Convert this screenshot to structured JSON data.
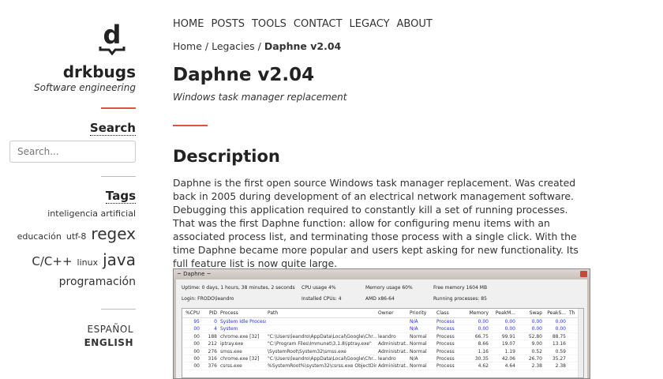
{
  "site": {
    "name": "drkbugs",
    "tagline": "Software engineering",
    "logo_letter": "d"
  },
  "search": {
    "heading": "Search",
    "placeholder": "Search..."
  },
  "tags": {
    "heading": "Tags",
    "items": [
      "inteligencia artificial",
      "educación",
      "utf-8",
      "regex",
      "C/C++",
      "linux",
      "java",
      "programación"
    ]
  },
  "languages": [
    "ESPAÑOL",
    "ENGLISH"
  ],
  "nav": [
    "HOME",
    "POSTS",
    "TOOLS",
    "CONTACT",
    "LEGACY",
    "ABOUT"
  ],
  "breadcrumb": {
    "home": "Home",
    "legacies": "Legacies",
    "current": "Daphne v2.04"
  },
  "page": {
    "title": "Daphne v2.04",
    "subtitle": "Windows task manager replacement",
    "section": "Description",
    "paragraph": "Daphne is the first open source Windows task manager replacement. Was created back in 2005 during development of an electrical network management software. Debugging this application required to constantly kill a set of running processes. That was the first Daphne function: allow for configuring menu items with an associated process list, and terminating those process with a single click. With the time Daphne became more popular and users kept asking for new functionality. Its full feature list is now quite large."
  },
  "screenshot": {
    "title": "~ Daphne ~",
    "info": [
      "Uptime: 0 days, 1 hours, 38 minutes, 2 seconds",
      "CPU usage  4%",
      "Memory usage  60%",
      "Free memory 1604 MB",
      "Login: FRODO\\leandro",
      "Installed CPUs:  4",
      "AMD x86-64",
      "Running processes:   85"
    ],
    "columns": [
      "%CPU",
      "PID",
      "Process",
      "Path",
      "Owner",
      "Priority",
      "Class",
      "Memory",
      "PeakM...",
      "Swap",
      "PeakS...",
      "Th"
    ],
    "rows": [
      [
        "95",
        "0",
        "System Idle Process",
        "",
        "",
        "N/A",
        "Process",
        "0.00",
        "0.00",
        "0.00",
        "0.00"
      ],
      [
        "00",
        "4",
        "System",
        "",
        "",
        "N/A",
        "Process",
        "0.00",
        "0.00",
        "0.00",
        "0.00"
      ],
      [
        "00",
        "188",
        "chrome.exe [32]",
        "\"C:\\Users\\leandro\\AppData\\Local\\Google\\Chr...",
        "leandro",
        "Normal",
        "Process",
        "66.75",
        "99.91",
        "52.80",
        "88.75"
      ],
      [
        "00",
        "212",
        "iptray.exe",
        "\"C:\\Program Files\\Immunet\\3.1.8\\iptray.exe\"",
        "Administrat...",
        "Normal",
        "Process",
        "8.66",
        "19.07",
        "9.00",
        "13.16"
      ],
      [
        "00",
        "276",
        "smss.exe",
        "\\SystemRoot\\System32\\smss.exe",
        "Administrat...",
        "Normal",
        "Process",
        "1.16",
        "1.19",
        "0.52",
        "0.59"
      ],
      [
        "00",
        "316",
        "chrome.exe [32]",
        "\"C:\\Users\\leandro\\AppData\\Local\\Google\\Chr...",
        "leandro",
        "N/A",
        "Process",
        "30.35",
        "42.06",
        "26.70",
        "35.27"
      ],
      [
        "00",
        "376",
        "csrss.exe",
        "%SystemRoot%\\system32\\csrss.exe ObjectDire...",
        "Administrat...",
        "Normal",
        "Process",
        "4.62",
        "4.64",
        "2.38",
        "2.38"
      ]
    ]
  },
  "colors": {
    "accent": "#d9573b",
    "text": "#333333",
    "link_blue": "#2233dd"
  }
}
